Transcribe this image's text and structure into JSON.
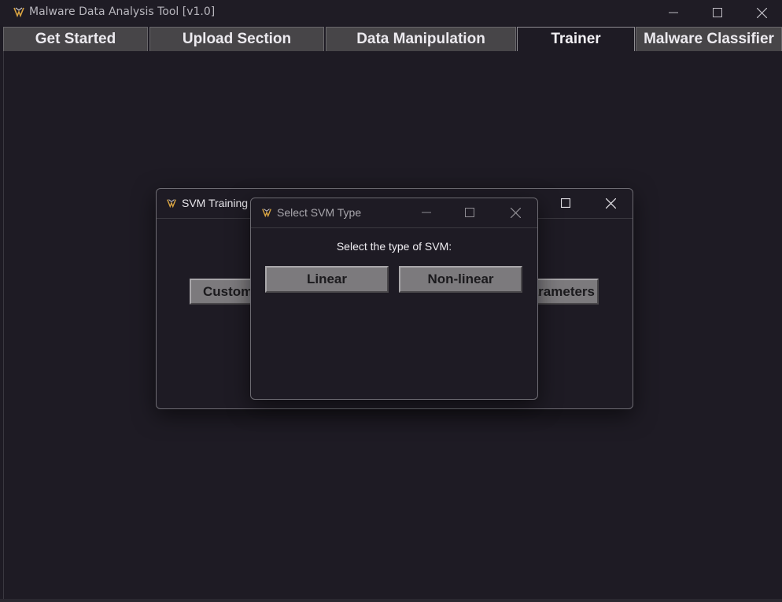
{
  "window": {
    "title": "Malware Data Analysis Tool [v1.0]",
    "controls": {
      "minimize": "minimize-icon",
      "maximize": "maximize-icon",
      "close": "close-icon"
    }
  },
  "tabs": [
    {
      "label": "Get Started",
      "active": false
    },
    {
      "label": "Upload Section",
      "active": false
    },
    {
      "label": "Data Manipulation",
      "active": false
    },
    {
      "label": "Trainer",
      "active": true
    },
    {
      "label": "Malware Classifier",
      "active": false
    }
  ],
  "svm_training_window": {
    "title": "SVM Training",
    "custom_button": "Custom",
    "parameters_button": "arameters"
  },
  "select_svm_dialog": {
    "title": "Select SVM Type",
    "prompt": "Select the type of SVM:",
    "linear_button": "Linear",
    "nonlinear_button": "Non-linear"
  },
  "colors": {
    "background": "#1e1b24",
    "tab": "#474548",
    "button": "#7c7a7d"
  }
}
